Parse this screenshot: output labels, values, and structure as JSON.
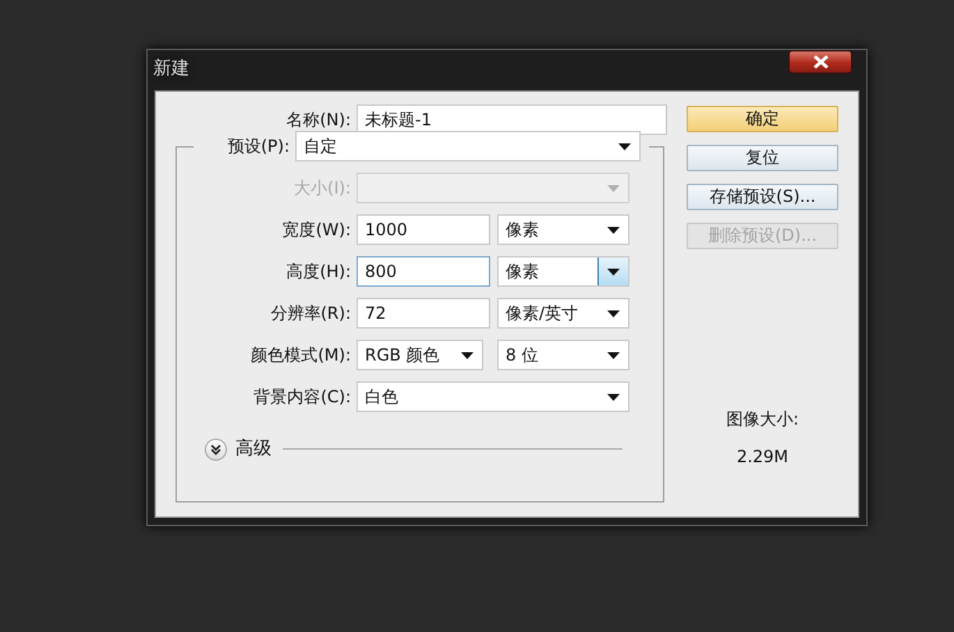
{
  "window": {
    "title": "新建"
  },
  "name_field": {
    "label": "名称(N):",
    "value": "未标题-1"
  },
  "preset": {
    "label": "预设(P):",
    "value": "自定"
  },
  "rows": [
    {
      "kind": "select",
      "label": "大小(I):",
      "disabled": true
    },
    {
      "kind": "input-unit",
      "label": "宽度(W):",
      "value": "1000",
      "unit": "像素",
      "focused": false
    },
    {
      "kind": "input-unit",
      "label": "高度(H):",
      "value": "800",
      "unit": "像素",
      "focused": true
    },
    {
      "kind": "input-unit",
      "label": "分辨率(R):",
      "value": "72",
      "unit": "像素/英寸",
      "focused": false
    },
    {
      "kind": "pair",
      "label": "颜色模式(M):",
      "value": "RGB 颜色",
      "unit": "8 位"
    },
    {
      "kind": "select",
      "label": "背景内容(C):",
      "value": "白色",
      "disabled": false
    }
  ],
  "advanced": {
    "label": "高级",
    "expanded": false
  },
  "buttons": [
    {
      "label": "确定",
      "default": true,
      "disabled": false
    },
    {
      "label": "复位",
      "default": false,
      "disabled": false
    },
    {
      "label": "存储预设(S)...",
      "default": false,
      "disabled": false
    },
    {
      "label": "删除预设(D)...",
      "default": false,
      "disabled": true
    }
  ],
  "image_size": {
    "label": "图像大小:",
    "value": "2.29M"
  }
}
